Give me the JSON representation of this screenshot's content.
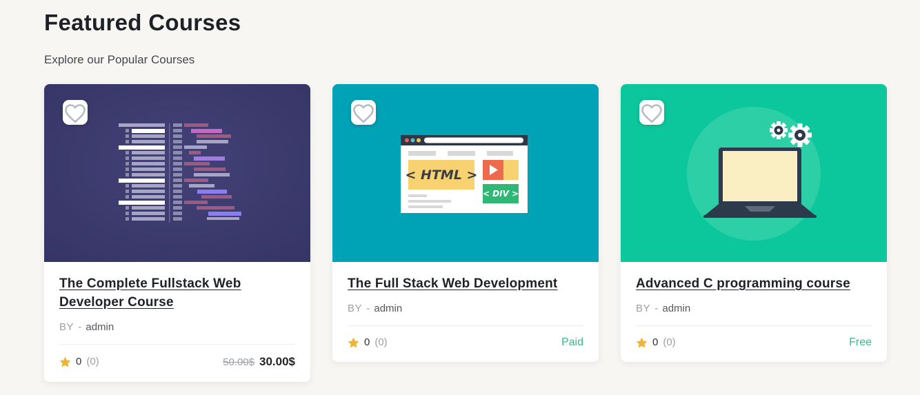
{
  "page": {
    "title": "Featured Courses",
    "subtitle": "Explore our Popular Courses"
  },
  "labels": {
    "by": "BY",
    "separator": "-"
  },
  "icons": {
    "wishlist": "heart-icon",
    "rating": "star-icon"
  },
  "colors": {
    "page_background": "#f7f6f3",
    "accent_green": "#3cb889",
    "star_yellow": "#f0b43c",
    "card1_illustration_bg": "#3a3969",
    "card2_illustration_bg": "#00a2b5",
    "card3_illustration_bg": "#0cc79c"
  },
  "cards": [
    {
      "title": "The Complete Fullstack Web Developer Course",
      "author": "admin",
      "rating": "0",
      "rating_count": "(0)",
      "price_old": "50.00$",
      "price": "30.00$",
      "illustration": "code-editor"
    },
    {
      "title": "The Full Stack Web Development",
      "author": "admin",
      "rating": "0",
      "rating_count": "(0)",
      "badge": "Paid",
      "illustration": "browser-html-div"
    },
    {
      "title": "Advanced C programming course",
      "author": "admin",
      "rating": "0",
      "rating_count": "(0)",
      "badge": "Free",
      "illustration": "laptop-gears"
    }
  ],
  "illustration_text": {
    "html": "< HTML >",
    "div": "< DIV >"
  }
}
